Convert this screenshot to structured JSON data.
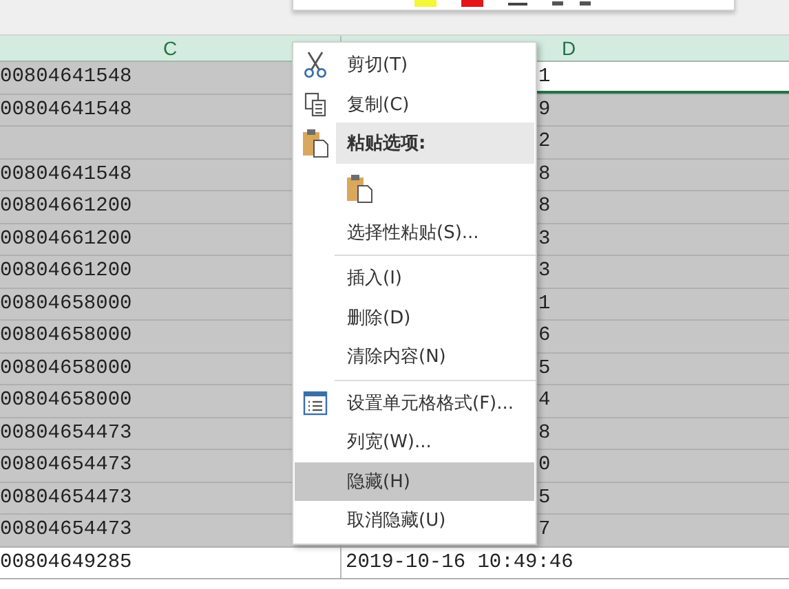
{
  "columns": [
    {
      "label": "C",
      "selected": true
    },
    {
      "label": "D",
      "selected": true
    }
  ],
  "rows": [
    {
      "c": "00804641548",
      "d": "1",
      "selected": true,
      "active": true,
      "d_cut": true
    },
    {
      "c": "00804641548",
      "d": "9",
      "selected": true,
      "active": false,
      "d_cut": true
    },
    {
      "c": "",
      "d": "2",
      "selected": true,
      "active": false,
      "d_cut": true
    },
    {
      "c": "00804641548",
      "d": "8",
      "selected": true,
      "active": false,
      "d_cut": true
    },
    {
      "c": "00804661200",
      "d": "8",
      "selected": true,
      "active": false,
      "d_cut": true
    },
    {
      "c": "00804661200",
      "d": "3",
      "selected": true,
      "active": false,
      "d_cut": true
    },
    {
      "c": "00804661200",
      "d": "3",
      "selected": true,
      "active": false,
      "d_cut": true
    },
    {
      "c": "00804658000",
      "d": "1",
      "selected": true,
      "active": false,
      "d_cut": true
    },
    {
      "c": "00804658000",
      "d": "6",
      "selected": true,
      "active": false,
      "d_cut": true
    },
    {
      "c": "00804658000",
      "d": "5",
      "selected": true,
      "active": false,
      "d_cut": true
    },
    {
      "c": "00804658000",
      "d": "4",
      "selected": true,
      "active": false,
      "d_cut": true
    },
    {
      "c": "00804654473",
      "d": "8",
      "selected": true,
      "active": false,
      "d_cut": true
    },
    {
      "c": "00804654473",
      "d": "0",
      "selected": true,
      "active": false,
      "d_cut": true
    },
    {
      "c": "00804654473",
      "d": "5",
      "selected": true,
      "active": false,
      "d_cut": true
    },
    {
      "c": "00804654473",
      "d": "7",
      "selected": true,
      "active": false,
      "d_cut": true
    },
    {
      "c": "00804649285",
      "d": "2019-10-16 10:49:46",
      "selected": false,
      "active": false,
      "d_cut": false
    }
  ],
  "context_menu": {
    "items": [
      {
        "kind": "item",
        "label": "剪切(T)",
        "selected": false
      },
      {
        "kind": "item",
        "label": "复制(C)",
        "selected": false
      },
      {
        "kind": "header",
        "label": "粘贴选项:"
      },
      {
        "kind": "paste-icon"
      },
      {
        "kind": "item",
        "label": "选择性粘贴(S)...",
        "selected": false
      },
      {
        "kind": "separator"
      },
      {
        "kind": "item",
        "label": "插入(I)",
        "selected": false
      },
      {
        "kind": "item",
        "label": "删除(D)",
        "selected": false
      },
      {
        "kind": "item",
        "label": "清除内容(N)",
        "selected": false
      },
      {
        "kind": "separator"
      },
      {
        "kind": "item",
        "label": "设置单元格格式(F)...",
        "selected": false
      },
      {
        "kind": "item",
        "label": "列宽(W)...",
        "selected": false
      },
      {
        "kind": "item",
        "label": "隐藏(H)",
        "selected": true
      },
      {
        "kind": "item",
        "label": "取消隐藏(U)",
        "selected": false
      }
    ]
  }
}
